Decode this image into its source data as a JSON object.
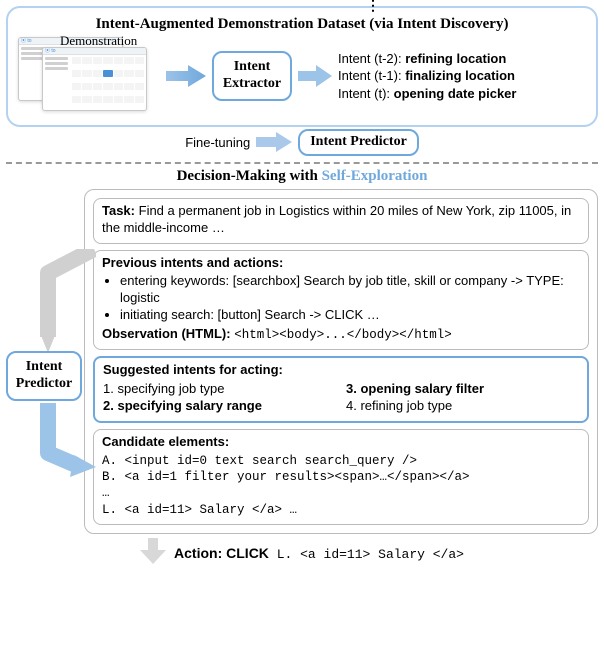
{
  "top": {
    "title_prefix": "Intent-Augmented Demonstration Dataset",
    "title_suffix": " (via Intent Discovery)",
    "demo_label": "Demonstration",
    "extractor_label_l1": "Intent",
    "extractor_label_l2": "Extractor",
    "intents": [
      {
        "label": "Intent (t-2):",
        "value": "refining location"
      },
      {
        "label": "Intent (t-1):",
        "value": "finalizing location"
      },
      {
        "label": "Intent (t):",
        "value": "opening date picker"
      }
    ],
    "vdots": "⋮"
  },
  "finetune": {
    "label": "Fine-tuning",
    "predictor_box": "Intent  Predictor"
  },
  "decision": {
    "heading_prefix": "Decision-Making with ",
    "heading_emph": "Self-Exploration",
    "predictor_l1": "Intent",
    "predictor_l2": "Predictor",
    "task": {
      "hdr": "Task:",
      "body": "Find a permanent job in Logistics within 20 miles of New York, zip 11005, in the middle-income …"
    },
    "prev": {
      "hdr": "Previous intents and actions:",
      "items": [
        "entering keywords: [searchbox] Search by job title, skill or company -> TYPE: logistic",
        "initiating search: [button]  Search -> CLICK   …"
      ],
      "obs_hdr": "Observation (HTML):",
      "obs_body": "<html><body>...</body></html>"
    },
    "suggested": {
      "hdr": "Suggested intents for acting:",
      "rows": [
        {
          "n": "1.",
          "text": "specifying job type",
          "bold": false
        },
        {
          "n": "3.",
          "text": "opening salary filter",
          "bold": true
        },
        {
          "n": "2.",
          "text": "specifying salary range",
          "bold": true
        },
        {
          "n": "4.",
          "text": "refining job type",
          "bold": false
        }
      ]
    },
    "candidates": {
      "hdr": "Candidate elements:",
      "lines": [
        "A. <input id=0 text search search_query />",
        "B. <a id=1 filter your results><span>…</span></a>",
        "…",
        "L. <a id=11> Salary </a>   …"
      ]
    },
    "action": {
      "hdr": "Action:",
      "verb": "CLICK",
      "rest": " L. <a id=11> Salary </a>"
    }
  }
}
